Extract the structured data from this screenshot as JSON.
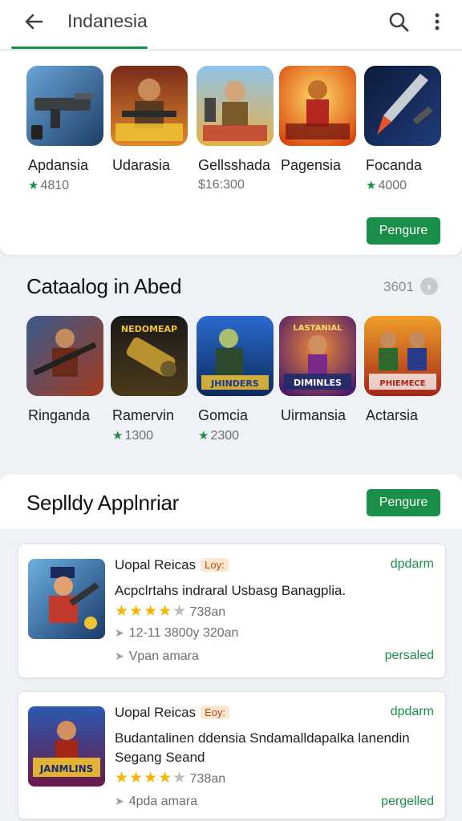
{
  "appbar": {
    "title": "Indanesia",
    "icons": [
      "arrow-back-icon",
      "search-icon",
      "more-vert-icon"
    ]
  },
  "section1": {
    "apps": [
      {
        "name": "Apdansia",
        "meta": "4810",
        "has_star": true,
        "icon": "gun-icon"
      },
      {
        "name": "Udarasia",
        "meta": "",
        "has_star": false,
        "icon": "soldier-icon"
      },
      {
        "name": "Gellsshada",
        "meta": "$16:300",
        "has_star": false,
        "icon": "warrior-icon"
      },
      {
        "name": "Pagensia",
        "meta": "",
        "has_star": false,
        "icon": "hero-icon"
      },
      {
        "name": "Focanda",
        "meta": "4000",
        "has_star": true,
        "icon": "rocket-icon"
      }
    ],
    "button": "Pengure"
  },
  "section2": {
    "title": "Cataalog in Abed",
    "count": "3601",
    "apps": [
      {
        "name": "Ringanda",
        "meta": "",
        "has_star": false,
        "icon": "soldier-icon"
      },
      {
        "name": "Ramervin",
        "meta": "1300",
        "has_star": true,
        "icon": "cannon-icon"
      },
      {
        "name": "Gomcia",
        "meta": "2300",
        "has_star": true,
        "icon": "soldier-icon"
      },
      {
        "name": "Uirmansia",
        "meta": "",
        "has_star": false,
        "icon": "hero-icon"
      },
      {
        "name": "Actarsia",
        "meta": "",
        "has_star": false,
        "icon": "soldiers-icon"
      }
    ],
    "icon_texts": [
      "NEDOMEAP",
      "JHINDERS",
      "DIMINLES",
      "PHIEMECE",
      "LASTANIAL"
    ]
  },
  "section3": {
    "title": "Seplldy Applnriar",
    "button": "Pengure",
    "items": [
      {
        "title": "Uopal Reicas",
        "badge": "Loy:",
        "right_top": "dpdarm",
        "desc": "Acpclrtahs indraral Usbasg Banagplia.",
        "rating_text": "738an",
        "line1": "12-11 3800y 320an",
        "line2": "Vpan amara",
        "right_bottom": "persaled"
      },
      {
        "title": "Uopal Reicas",
        "badge": "Eoy:",
        "right_top": "dpdarm",
        "desc": "Budantalinen ddensia Sndamalldapalka lanendin Segang Seand",
        "rating_text": "738an",
        "line2": "4pda amara",
        "right_bottom": "pergelled"
      }
    ],
    "icon_texts": [
      "JANMLINS"
    ]
  },
  "colors": {
    "accent": "#1a8f4a",
    "star": "#f4b400",
    "badge_bg": "#fde7cf",
    "badge_text": "#c5431a"
  }
}
